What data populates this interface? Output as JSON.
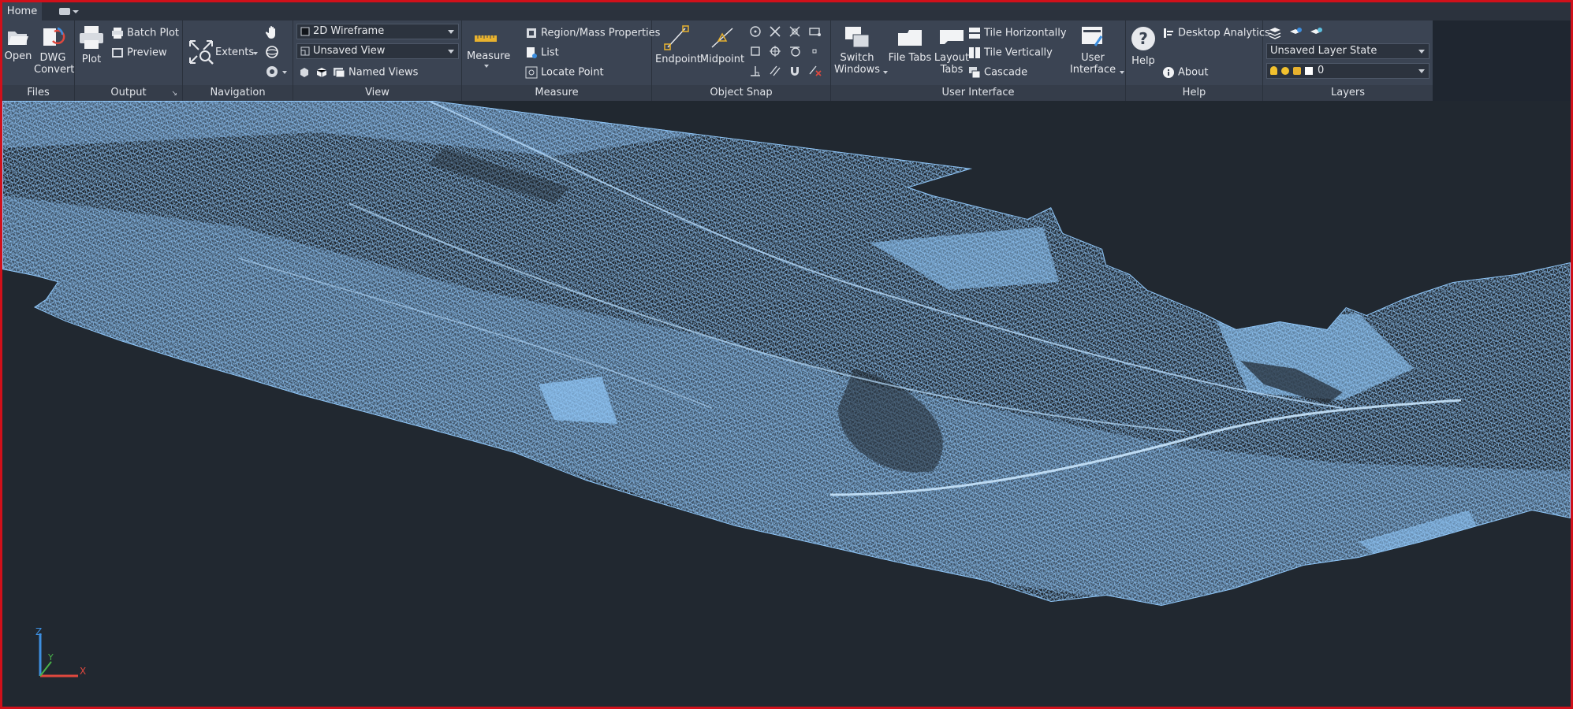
{
  "tabs": {
    "home": "Home"
  },
  "panels": {
    "files": {
      "title": "Files",
      "open": "Open",
      "dwg_convert_1": "DWG",
      "dwg_convert_2": "Convert"
    },
    "output": {
      "title": "Output",
      "plot": "Plot",
      "batch_plot": "Batch Plot",
      "preview": "Preview"
    },
    "navigation": {
      "title": "Navigation",
      "extents": "Extents"
    },
    "view": {
      "title": "View",
      "visual_style": "2D Wireframe",
      "saved_view": "Unsaved View",
      "named_views": "Named Views"
    },
    "measure": {
      "title": "Measure",
      "measure": "Measure",
      "region_mass": "Region/Mass Properties",
      "list": "List",
      "locate_point": "Locate Point"
    },
    "object_snap": {
      "title": "Object Snap",
      "endpoint": "Endpoint",
      "midpoint": "Midpoint"
    },
    "user_interface": {
      "title": "User Interface",
      "switch_windows_1": "Switch",
      "switch_windows_2": "Windows",
      "file_tabs": "File Tabs",
      "layout_tabs_1": "Layout",
      "layout_tabs_2": "Tabs",
      "tile_h": "Tile Horizontally",
      "tile_v": "Tile Vertically",
      "cascade": "Cascade",
      "user_interface_1": "User",
      "user_interface_2": "Interface"
    },
    "help": {
      "title": "Help",
      "help": "Help",
      "desktop_analytics": "Desktop Analytics",
      "about": "About"
    },
    "layers": {
      "title": "Layers",
      "layer_state": "Unsaved Layer State",
      "current_layer": "0"
    }
  },
  "ucs": {
    "x": "X",
    "y": "Y",
    "z": "Z"
  },
  "colors": {
    "mesh": "#8ec4f5",
    "accent": "#d0101a",
    "background": "#212830"
  }
}
